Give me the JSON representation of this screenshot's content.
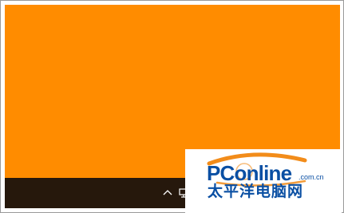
{
  "colors": {
    "desktop_background": "#ff8c00",
    "taskbar_background": "#26180c",
    "watermark_blue": "#0a4fa3",
    "watermark_orange": "#f28c1a"
  },
  "taskbar": {
    "tray": {
      "show_hidden_icons": "chevron-up-icon",
      "partial_icon": "network-icon"
    }
  },
  "watermark": {
    "brand": "PConline",
    "domain": ".com.cn",
    "chinese_name": "太平洋电脑网"
  }
}
